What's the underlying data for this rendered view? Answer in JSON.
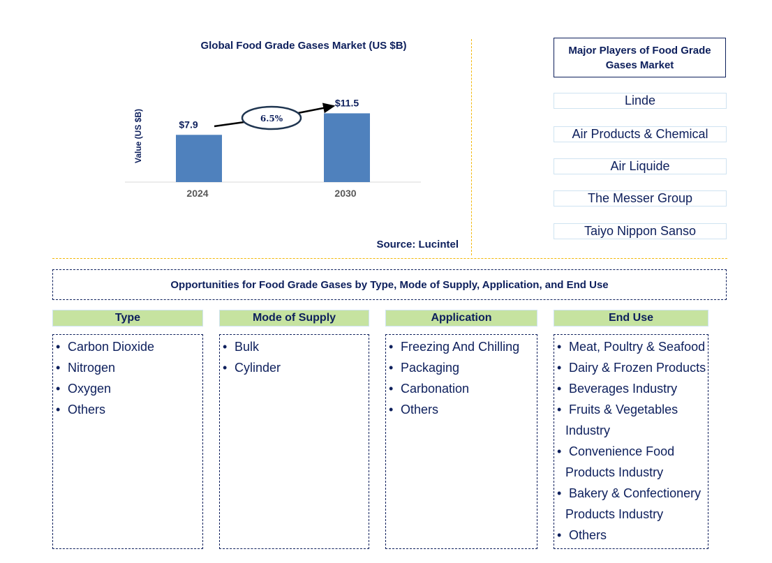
{
  "chart_data": {
    "type": "bar",
    "title": "Global Food Grade Gases Market (US $B)",
    "xlabel": "",
    "ylabel": "Value (US $B)",
    "categories": [
      "2024",
      "2030"
    ],
    "values": [
      7.9,
      11.5
    ],
    "data_labels": [
      "$7.9",
      "$11.5"
    ],
    "ylim": [
      0,
      14
    ],
    "grid": false,
    "bar_color": "#4f81bd",
    "annotation": {
      "type": "cagr-arrow",
      "text": "6.5%"
    }
  },
  "source": "Source: Lucintel",
  "players": {
    "header": "Major Players of Food Grade Gases Market",
    "items": [
      "Linde",
      "Air Products & Chemical",
      "Air Liquide",
      "The Messer Group",
      "Taiyo Nippon Sanso"
    ]
  },
  "opportunities": {
    "title": "Opportunities for Food Grade Gases by Type, Mode of Supply, Application, and End Use",
    "categories": [
      {
        "header": "Type",
        "items": [
          "Carbon Dioxide",
          "Nitrogen",
          "Oxygen",
          "Others"
        ]
      },
      {
        "header": "Mode of Supply",
        "items": [
          "Bulk",
          "Cylinder"
        ]
      },
      {
        "header": "Application",
        "items": [
          "Freezing And Chilling",
          "Packaging",
          "Carbonation",
          "Others"
        ]
      },
      {
        "header": "End Use",
        "items": [
          "Meat, Poultry & Seafood",
          "Dairy & Frozen Products",
          "Beverages Industry",
          "Fruits & Vegetables Industry",
          "Convenience Food Products Industry",
          "Bakery & Confectionery Products Industry",
          "Others"
        ]
      }
    ]
  },
  "colors": {
    "text": "#0d1f5c",
    "bar": "#4f81bd",
    "header_fill": "#c6e3a0",
    "divider": "#f2b705"
  }
}
